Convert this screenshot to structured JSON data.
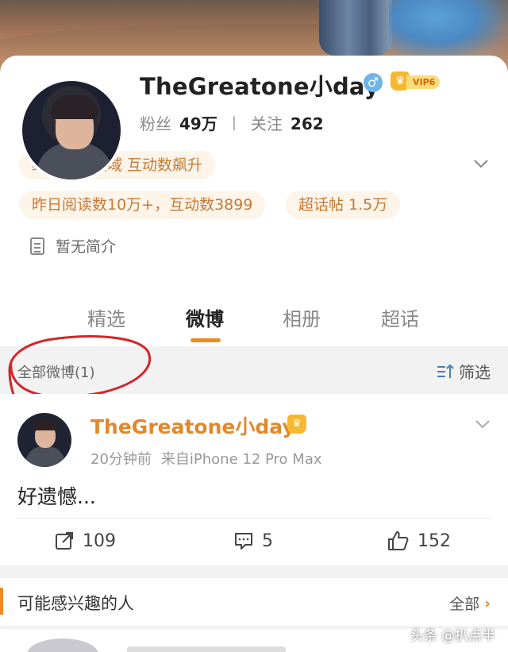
{
  "profile": {
    "name": "TheGreatone小day",
    "gender_icon": "male-icon",
    "vip_level": "VIP6",
    "followers_label": "粉丝",
    "followers": "49万",
    "following_label": "关注",
    "following": "262",
    "stats_separator": "|",
    "tags": [
      "综艺节目领域 互动数飙升",
      "昨日阅读数10万+，互动数3899",
      "超话帖 1.5万"
    ],
    "bio": "暂无简介"
  },
  "tabs": [
    "精选",
    "微博",
    "相册",
    "超话"
  ],
  "active_tab": "微博",
  "filter": {
    "all_label": "全部微博(1)",
    "screen_label": "筛选"
  },
  "post": {
    "author": "TheGreatone小day",
    "time": "20分钟前",
    "source": "来自iPhone 12 Pro Max",
    "text": "好遗憾...",
    "reposts": "109",
    "comments": "5",
    "likes": "152"
  },
  "suggest": {
    "title": "可能感兴趣的人",
    "all_label": "全部",
    "arrow": "›"
  },
  "watermark": "头条 @扒点半",
  "colors": {
    "accent": "#f08a24",
    "name_orange": "#e0892c",
    "tag_text": "#c77a34",
    "tag_bg": "#fdf4ea",
    "annotation_red": "#d4252a"
  }
}
